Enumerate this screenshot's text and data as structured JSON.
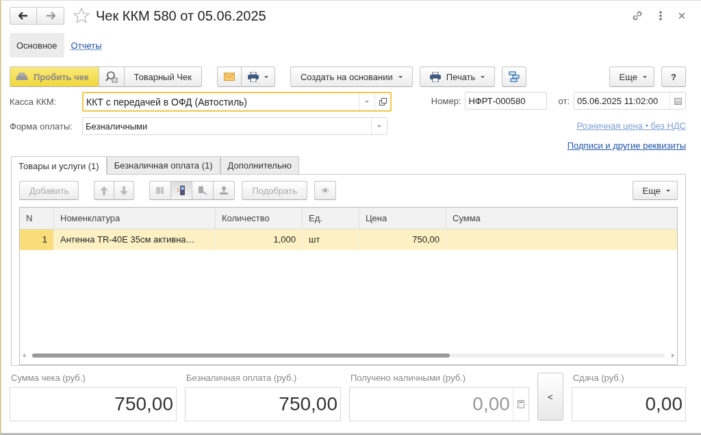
{
  "window": {
    "title": "Чек ККМ 580 от 05.06.2025"
  },
  "sections": [
    {
      "label": "Основное",
      "selected": true
    },
    {
      "label": "Отчеты",
      "selected": false
    }
  ],
  "toolbar": {
    "post_button": "Пробить чек",
    "receipt_button": "Товарный Чек",
    "create_button": "Создать на основании",
    "print_button": "Печать",
    "more_button": "Еще",
    "help_button": "?"
  },
  "fields": {
    "register_label": "Касса ККМ:",
    "register_value": "ККТ с передачей в ОФД (Автостиль)",
    "number_label": "Номер:",
    "number_value": "НФРТ-000580",
    "date_label": "от:",
    "date_value": "05.06.2025 11:02:00",
    "payment_label": "Форма оплаты:",
    "payment_value": "Безналичными"
  },
  "links": [
    {
      "label": "Розничная цена • без НДС",
      "disabled": true
    },
    {
      "label": "Подписи и другие реквизиты",
      "disabled": false
    }
  ],
  "tabs": [
    {
      "label": "Товары и услуги (1)",
      "selected": true
    },
    {
      "label": "Безналичная оплата (1)",
      "selected": false
    },
    {
      "label": "Дополнительно",
      "selected": false
    }
  ],
  "table_toolbar": {
    "add_button": {
      "label": "Добавить",
      "disabled": true
    },
    "pick_button": {
      "label": "Подобрать",
      "disabled": true
    },
    "more_button": "Еще"
  },
  "table": {
    "columns": [
      "N",
      "Номенклатура",
      "Количество",
      "Ед.",
      "Цена",
      "Сумма"
    ],
    "rows": [
      {
        "cells": [
          "1",
          "Антенна TR-40E 35см активна…",
          "1,000",
          "шт",
          "750,00"
        ],
        "selected": true
      }
    ]
  },
  "totals": [
    {
      "label": "Сумма чека (руб.)",
      "value": "750,00",
      "disabled": false,
      "kind": "plain"
    },
    {
      "label": "Безналичная оплата (руб.)",
      "value": "750,00",
      "disabled": false,
      "kind": "plain"
    },
    {
      "label": "Получено наличными (руб.)",
      "value": "0,00",
      "disabled": true,
      "kind": "calc"
    },
    {
      "label": "Сдача (руб.)",
      "value": "0,00",
      "disabled": false,
      "kind": "plain"
    }
  ],
  "change_button": "<"
}
